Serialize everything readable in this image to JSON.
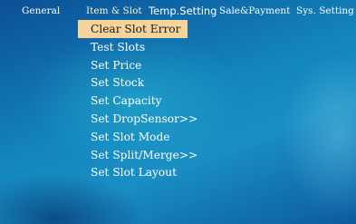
{
  "menubar": {
    "tabs": [
      {
        "label": "General"
      },
      {
        "label": "Item & Slot"
      },
      {
        "label": "Temp.Setting"
      },
      {
        "label": "Sale&Payment"
      },
      {
        "label": "Sys. Setting"
      }
    ],
    "active_tab": "Item & Slot"
  },
  "submenu": {
    "items": [
      {
        "label": "Clear Slot Error"
      },
      {
        "label": "Test Slots"
      },
      {
        "label": "Set Price"
      },
      {
        "label": "Set Stock"
      },
      {
        "label": "Set Capacity"
      },
      {
        "label": "Set DropSensor>>"
      },
      {
        "label": "Set Slot Mode"
      },
      {
        "label": "Set Split/Merge>>"
      },
      {
        "label": "Set Slot Layout"
      }
    ],
    "selected_item": "Clear Slot Error"
  },
  "colors": {
    "background": "#1384bd",
    "selected_highlight": "#f7d49b",
    "text": "#ffffff"
  }
}
